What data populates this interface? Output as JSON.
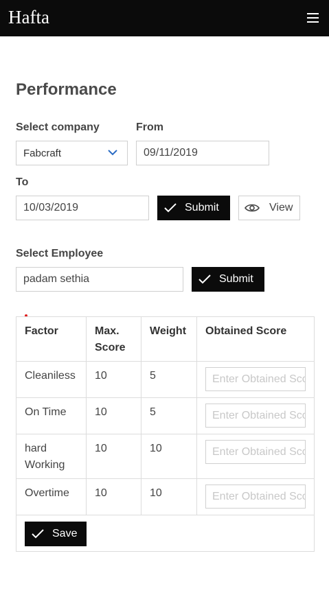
{
  "header": {
    "brand": "Hafta",
    "menu_icon": "hamburger-icon"
  },
  "page": {
    "title": "Performance"
  },
  "filters": {
    "company_label": "Select company",
    "company_value": "Fabcraft",
    "from_label": "From",
    "from_value": "09/11/2019",
    "to_label": "To",
    "to_value": "10/03/2019",
    "submit_label": "Submit",
    "view_label": "View"
  },
  "employee": {
    "label": "Select Employee",
    "value": "padam sethia",
    "submit_label": "Submit"
  },
  "table": {
    "headers": {
      "factor": "Factor",
      "max_score": "Max. Score",
      "weight": "Weight",
      "obtained": "Obtained Score"
    },
    "placeholder": "Enter Obtained Score",
    "rows": [
      {
        "factor": "Cleaniless",
        "max": "10",
        "weight": "5"
      },
      {
        "factor": "On Time",
        "max": "10",
        "weight": "5"
      },
      {
        "factor": "hard Working",
        "max": "10",
        "weight": "10"
      },
      {
        "factor": "Overtime",
        "max": "10",
        "weight": "10"
      }
    ],
    "save_label": "Save"
  },
  "colors": {
    "topbar": "#0b0b0b",
    "button_dark": "#0b0b0b",
    "chevron": "#2b6cc4"
  }
}
